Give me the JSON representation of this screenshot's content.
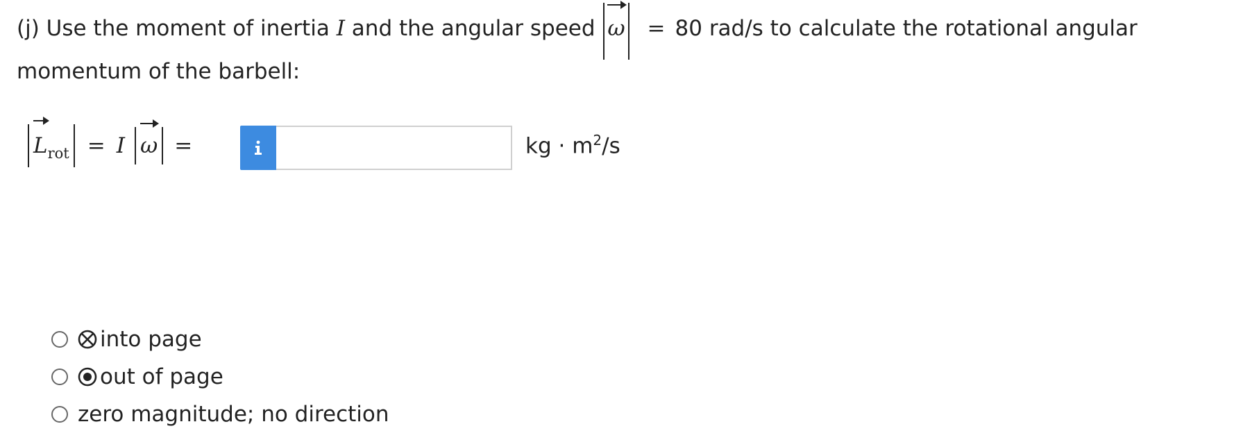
{
  "question": {
    "intro": "(j) Use the moment of inertia",
    "inertia_symbol": "I",
    "middle": "and the angular speed",
    "omega_symbol": "ω",
    "equals": "=",
    "value_text": "80 rad/s to calculate the rotational angular momentum of the barbell:"
  },
  "equation": {
    "L_symbol": "L",
    "L_subscript": "rot",
    "equals1": "=",
    "I_symbol": "I",
    "omega_symbol": "ω",
    "equals2": "="
  },
  "answer": {
    "info_icon": "info-icon",
    "value": "",
    "placeholder": "",
    "unit_prefix": "kg · m",
    "unit_exp": "2",
    "unit_suffix": "/s"
  },
  "direction_options": [
    {
      "label": "into page",
      "icon": "into-page-icon",
      "selected": false
    },
    {
      "label": "out of page",
      "icon": "out-of-page-icon",
      "selected": false
    },
    {
      "label": "zero magnitude; no direction",
      "icon": "",
      "selected": false
    }
  ],
  "colors": {
    "info_button": "#3d8be0",
    "text": "#222222",
    "input_border": "#cfcfcf"
  }
}
